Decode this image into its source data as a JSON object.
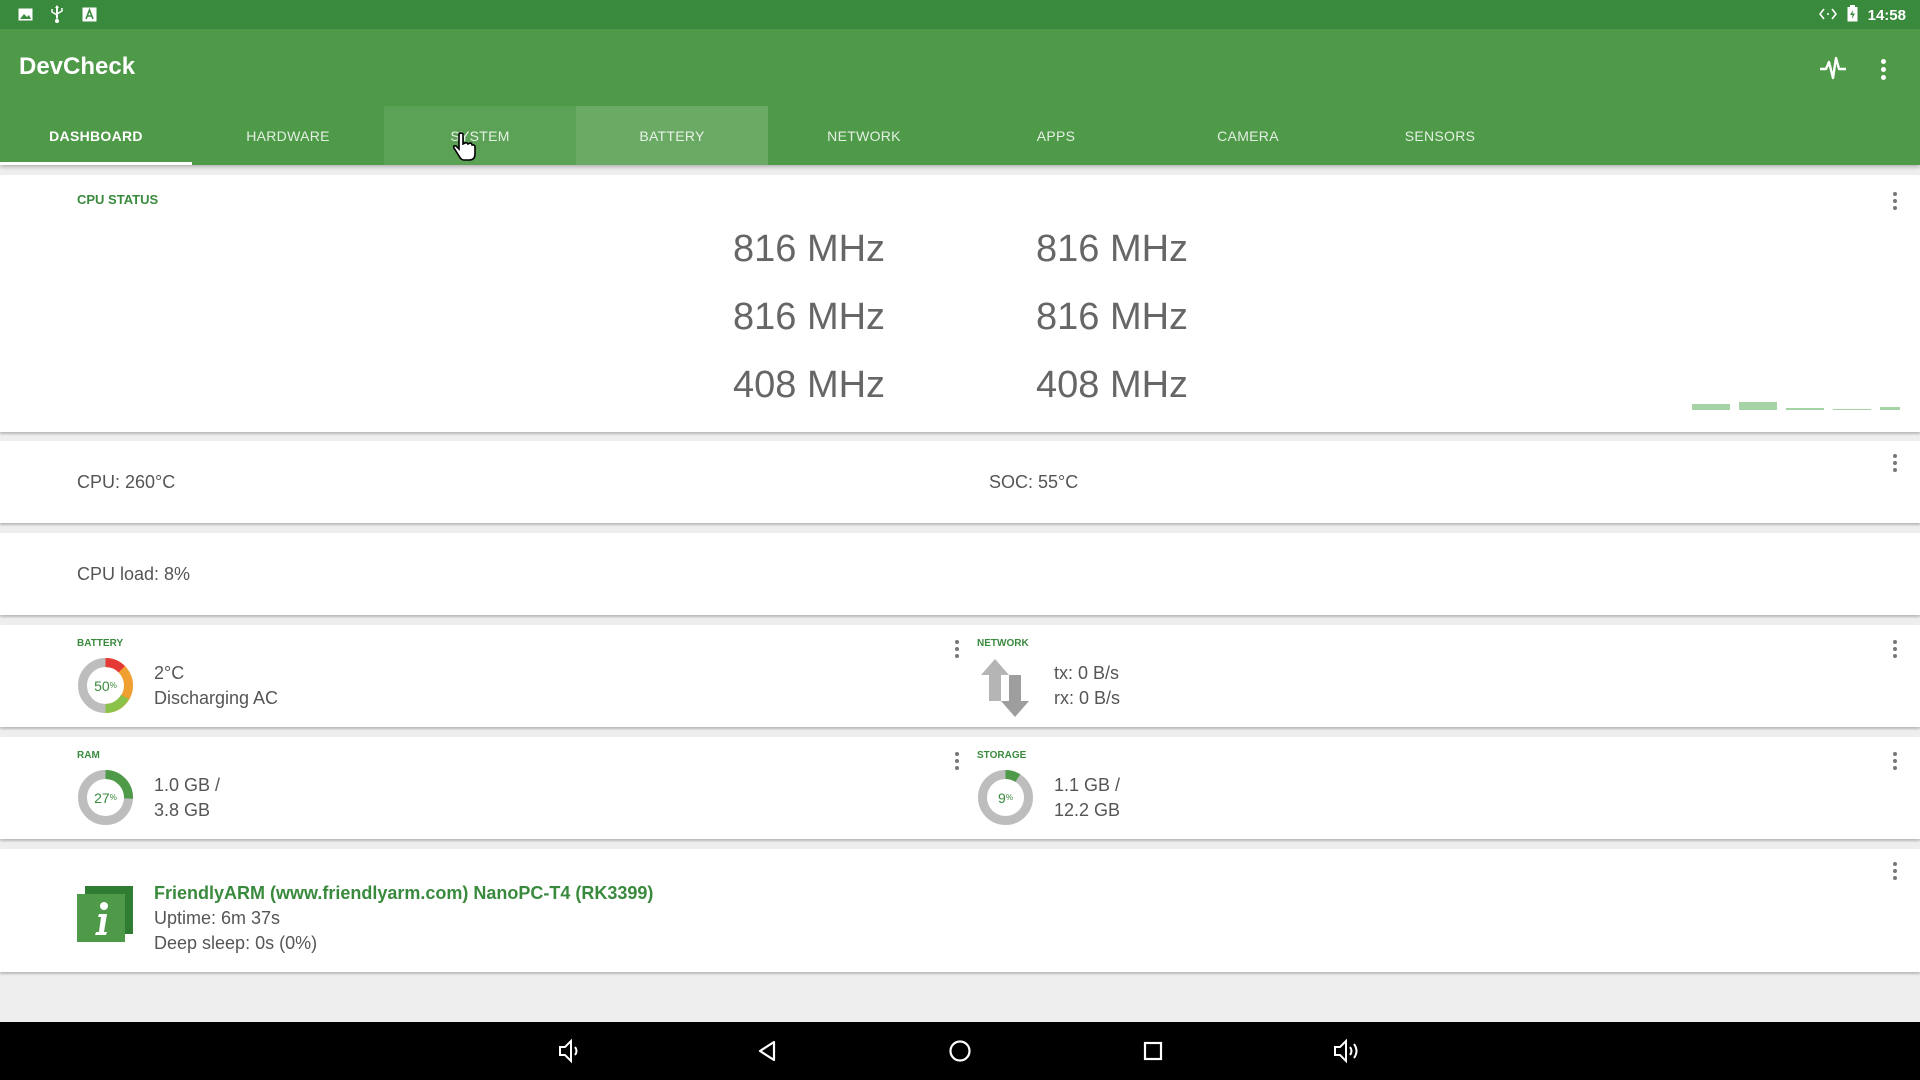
{
  "status_bar": {
    "left_icons": [
      "image-icon",
      "usb-icon",
      "text-icon"
    ],
    "time": "14:58"
  },
  "app": {
    "title": "DevCheck",
    "actions": [
      "pulse-icon",
      "overflow-menu-icon"
    ],
    "tabs": [
      {
        "label": "DASHBOARD",
        "active": true
      },
      {
        "label": "HARDWARE"
      },
      {
        "label": "SYSTEM"
      },
      {
        "label": "BATTERY"
      },
      {
        "label": "NETWORK"
      },
      {
        "label": "APPS"
      },
      {
        "label": "CAMERA"
      },
      {
        "label": "SENSORS"
      }
    ]
  },
  "cpu_status": {
    "title": "CPU STATUS",
    "cores": [
      "816 MHz",
      "816 MHz",
      "816 MHz",
      "816 MHz",
      "408 MHz",
      "408 MHz"
    ]
  },
  "temps": {
    "cpu": "CPU: 260°C",
    "soc": "SOC: 55°C"
  },
  "cpu_load": {
    "text": "CPU load: 8%"
  },
  "battery": {
    "label": "BATTERY",
    "percent": "50",
    "percent_unit": "%",
    "temp": "2°C",
    "state": "Discharging AC",
    "level": 0.5
  },
  "network": {
    "label": "NETWORK",
    "tx": "tx: 0 B/s",
    "rx": "rx: 0 B/s"
  },
  "ram": {
    "label": "RAM",
    "percent": "27",
    "percent_unit": "%",
    "used": "1.0 GB /",
    "total": "3.8 GB",
    "level": 0.27
  },
  "storage": {
    "label": "STORAGE",
    "percent": "9",
    "percent_unit": "%",
    "used": "1.1 GB /",
    "total": "12.2 GB",
    "level": 0.09
  },
  "device": {
    "name": "FriendlyARM (www.friendlyarm.com) NanoPC-T4 (RK3399)",
    "uptime": "Uptime: 6m 37s",
    "deep_sleep": "Deep sleep: 0s (0%)"
  },
  "colors": {
    "primary": "#4e9a48",
    "primary_dark": "#3a8a3e",
    "accent_green": "#3a8a3e"
  }
}
